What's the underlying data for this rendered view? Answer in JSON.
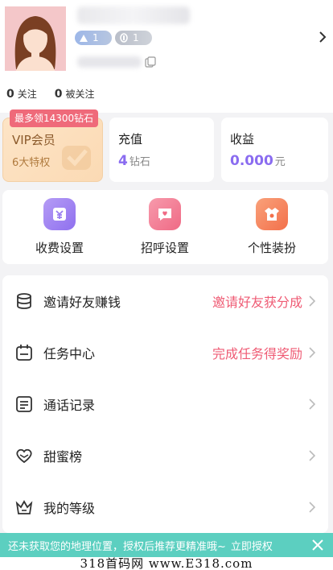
{
  "profile": {
    "level_badge": "1",
    "gem_badge": "1",
    "following_count": "0",
    "following_label": "关注",
    "followers_count": "0",
    "followers_label": "被关注"
  },
  "cards": {
    "vip_tag": "最多领14300钻石",
    "vip_title": "VIP会员",
    "vip_sub": "6大特权",
    "recharge_title": "充值",
    "recharge_amount": "4",
    "recharge_unit": "钻石",
    "income_title": "收益",
    "income_amount": "0.000",
    "income_unit": "元"
  },
  "quick_actions": [
    {
      "label": "收费设置",
      "icon": "yen-tag-icon",
      "color": "#a98df3"
    },
    {
      "label": "招呼设置",
      "icon": "chat-heart-icon",
      "color": "#f27c93"
    },
    {
      "label": "个性装扮",
      "icon": "costume-icon",
      "color": "#f6875c"
    }
  ],
  "menu": [
    {
      "label": "邀请好友赚钱",
      "hint": "邀请好友获分成",
      "icon": "coins-stack-icon"
    },
    {
      "label": "任务中心",
      "hint": "完成任务得奖励",
      "icon": "calendar-icon"
    },
    {
      "label": "通话记录",
      "hint": "",
      "icon": "document-icon"
    },
    {
      "label": "甜蜜榜",
      "hint": "",
      "icon": "heart-icon"
    },
    {
      "label": "我的等级",
      "hint": "",
      "icon": "crown-icon"
    }
  ],
  "toast": {
    "message": "还未获取您的地理位置，授权后推荐更精准哦~",
    "action": "立即授权"
  },
  "watermark": "318首码网 www.E318.com",
  "colors": {
    "accent_pink": "#ef5b74",
    "accent_purple": "#8a6cf0",
    "toast_teal": "#5ccfc0"
  }
}
